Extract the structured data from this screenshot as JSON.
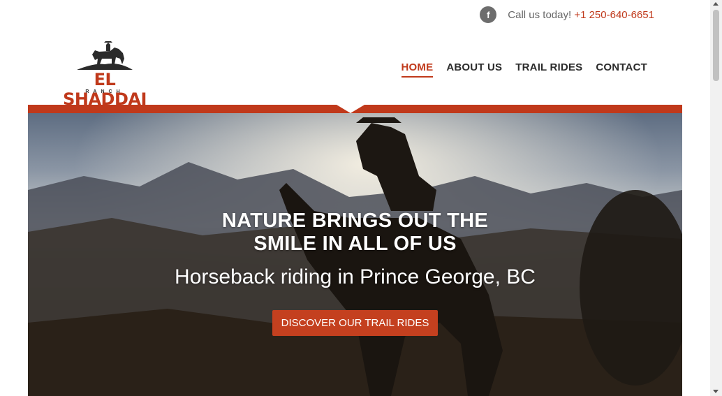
{
  "topbar": {
    "facebook_icon_glyph": "f",
    "call_label": "Call us today! ",
    "phone": "+1 250-640-6651"
  },
  "logo": {
    "title": "EL SHADDAI",
    "subtitle": "RANCH"
  },
  "nav": {
    "items": [
      {
        "label": "HOME",
        "active": true
      },
      {
        "label": "ABOUT US",
        "active": false
      },
      {
        "label": "TRAIL RIDES",
        "active": false
      },
      {
        "label": "CONTACT",
        "active": false
      }
    ]
  },
  "hero": {
    "headline_line1": "NATURE BRINGS OUT THE",
    "headline_line2": "SMILE IN ALL OF US",
    "subheadline": "Horseback riding in Prince George, BC",
    "cta_label": "DISCOVER OUR TRAIL RIDES"
  },
  "colors": {
    "accent": "#c0391b",
    "button": "#c4401f",
    "nav_text": "#2b2b2b"
  }
}
